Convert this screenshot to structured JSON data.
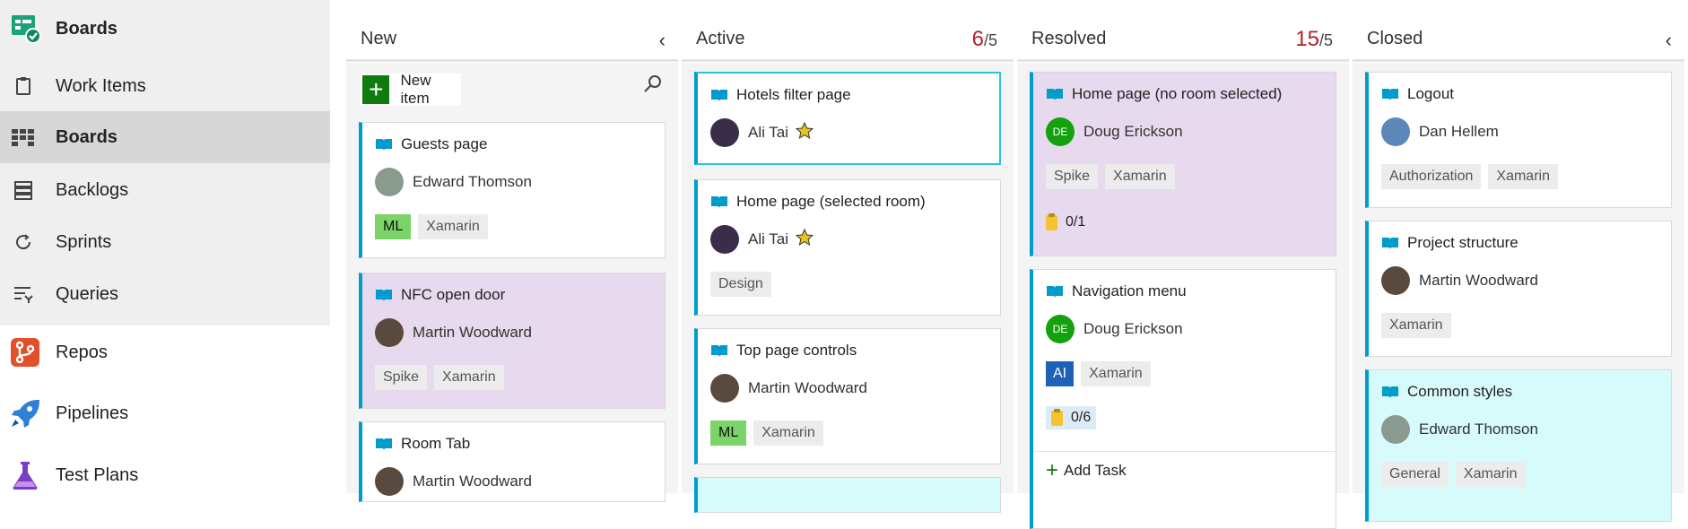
{
  "sidebar": {
    "boards_header": "Boards",
    "items": [
      {
        "label": "Work Items",
        "icon": "work-items-icon"
      },
      {
        "label": "Boards",
        "icon": "boards-grid-icon",
        "selected": true
      },
      {
        "label": "Backlogs",
        "icon": "backlogs-icon"
      },
      {
        "label": "Sprints",
        "icon": "sprints-icon"
      },
      {
        "label": "Queries",
        "icon": "queries-icon"
      },
      {
        "label": "Repos",
        "icon": "repos-icon"
      },
      {
        "label": "Pipelines",
        "icon": "pipelines-icon"
      },
      {
        "label": "Test Plans",
        "icon": "test-plans-icon"
      }
    ]
  },
  "colors": {
    "accent": "#009ccc",
    "purple_card": "#e7d9ee",
    "cyan_card": "#d7fafa",
    "over_limit": "#b0242a",
    "tag_ml": "#7bd36a",
    "tag_ai": "#1e62b7",
    "avatar_de": "#13a10e"
  },
  "board": {
    "columns": [
      {
        "title": "New",
        "new_item_label": "New item",
        "cards": [
          {
            "title": "Guests page",
            "assignee": "Edward Thomson",
            "tags": [
              "ML",
              "Xamarin"
            ]
          },
          {
            "title": "NFC open door",
            "assignee": "Martin Woodward",
            "tags": [
              "Spike",
              "Xamarin"
            ]
          },
          {
            "title": "Room Tab",
            "assignee": "Martin Woodward",
            "tags": []
          }
        ]
      },
      {
        "title": "Active",
        "count": "6",
        "limit": "/5",
        "cards": [
          {
            "title": "Hotels filter page",
            "assignee": "Ali Tai",
            "tags": []
          },
          {
            "title": "Home page (selected room)",
            "assignee": "Ali Tai",
            "tags": [
              "Design"
            ]
          },
          {
            "title": "Top page controls",
            "assignee": "Martin Woodward",
            "tags": [
              "ML",
              "Xamarin"
            ]
          }
        ]
      },
      {
        "title": "Resolved",
        "count": "15",
        "limit": "/5",
        "cards": [
          {
            "title": "Home page (no room selected)",
            "assignee": "Doug Erickson",
            "avatar_initials": "DE",
            "tags": [
              "Spike",
              "Xamarin"
            ],
            "tasks": "0/1"
          },
          {
            "title": "Navigation menu",
            "assignee": "Doug Erickson",
            "avatar_initials": "DE",
            "tags": [
              "AI",
              "Xamarin"
            ],
            "tasks": "0/6",
            "add_task": "Add Task"
          }
        ]
      },
      {
        "title": "Closed",
        "cards": [
          {
            "title": "Logout",
            "assignee": "Dan Hellem",
            "tags": [
              "Authorization",
              "Xamarin"
            ]
          },
          {
            "title": "Project structure",
            "assignee": "Martin Woodward",
            "tags": [
              "Xamarin"
            ]
          },
          {
            "title": "Common styles",
            "assignee": "Edward Thomson",
            "tags": [
              "General",
              "Xamarin"
            ]
          }
        ]
      }
    ]
  }
}
